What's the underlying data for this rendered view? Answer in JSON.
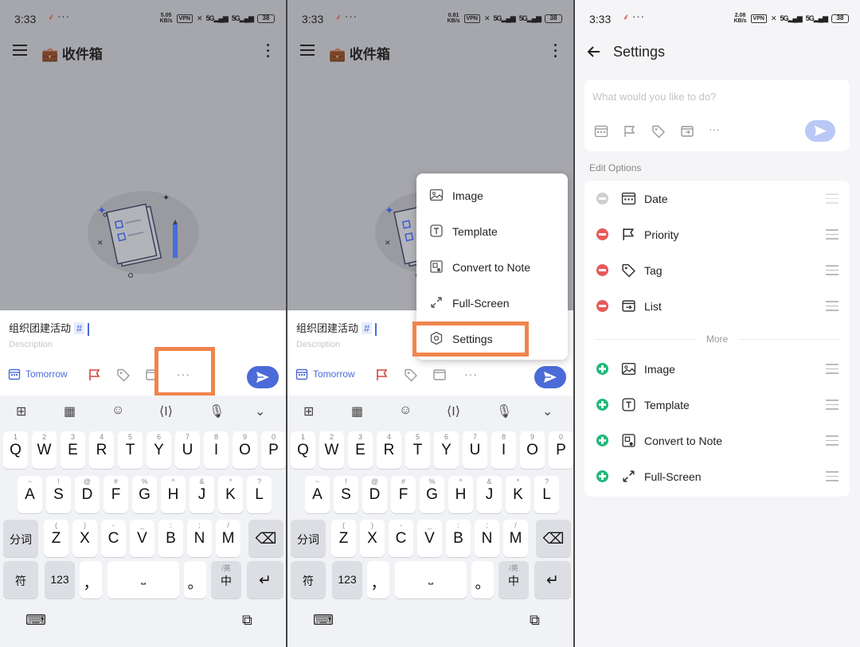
{
  "status_bar": {
    "time": "3:33",
    "dots": "···",
    "speeds": [
      "5.05",
      "0.81",
      "2.08"
    ],
    "speed_unit": "KB/s",
    "vpn": "VPN",
    "network": "5G",
    "battery": "38"
  },
  "app": {
    "title": "收件箱",
    "title_icon": "briefcase-icon"
  },
  "task_input": {
    "title_value": "组织团建活动",
    "tag_symbol": "#",
    "description_placeholder": "Description",
    "date_label": "Tomorrow",
    "more_label": "···"
  },
  "keyboard": {
    "row1": [
      {
        "main": "Q",
        "sub": "1"
      },
      {
        "main": "W",
        "sub": "2"
      },
      {
        "main": "E",
        "sub": "3"
      },
      {
        "main": "R",
        "sub": "4"
      },
      {
        "main": "T",
        "sub": "5"
      },
      {
        "main": "Y",
        "sub": "6"
      },
      {
        "main": "U",
        "sub": "7"
      },
      {
        "main": "I",
        "sub": "8"
      },
      {
        "main": "O",
        "sub": "9"
      },
      {
        "main": "P",
        "sub": "0"
      }
    ],
    "row2": [
      {
        "main": "A",
        "sub": "~"
      },
      {
        "main": "S",
        "sub": "!"
      },
      {
        "main": "D",
        "sub": "@"
      },
      {
        "main": "F",
        "sub": "#"
      },
      {
        "main": "G",
        "sub": "%"
      },
      {
        "main": "H",
        "sub": "^"
      },
      {
        "main": "J",
        "sub": "&"
      },
      {
        "main": "K",
        "sub": "*"
      },
      {
        "main": "L",
        "sub": "?"
      }
    ],
    "row3": [
      {
        "main": "Z",
        "sub": "("
      },
      {
        "main": "X",
        "sub": ")"
      },
      {
        "main": "C",
        "sub": "-"
      },
      {
        "main": "V",
        "sub": "_"
      },
      {
        "main": "B",
        "sub": ":"
      },
      {
        "main": "N",
        "sub": ";"
      },
      {
        "main": "M",
        "sub": "/"
      }
    ],
    "segment_key": "分词",
    "symbol_key": "符",
    "number_key": "123",
    "comma_key": "，",
    "period_key": "。",
    "lang_key": "中",
    "lang_sub": "/英"
  },
  "popup_menu": {
    "items": [
      {
        "label": "Image",
        "icon": "image-icon"
      },
      {
        "label": "Template",
        "icon": "template-icon"
      },
      {
        "label": "Convert to Note",
        "icon": "convert-note-icon"
      },
      {
        "label": "Full-Screen",
        "icon": "fullscreen-icon"
      },
      {
        "label": "Settings",
        "icon": "settings-hexagon-icon"
      }
    ]
  },
  "settings": {
    "title": "Settings",
    "quick_add_placeholder": "What would you like to do?",
    "section_label": "Edit Options",
    "more_label": "More",
    "enabled_options": [
      {
        "label": "Date",
        "icon": "calendar-icon",
        "state": "locked"
      },
      {
        "label": "Priority",
        "icon": "flag-icon",
        "state": "remove"
      },
      {
        "label": "Tag",
        "icon": "tag-icon",
        "state": "remove"
      },
      {
        "label": "List",
        "icon": "list-move-icon",
        "state": "remove"
      }
    ],
    "more_options": [
      {
        "label": "Image",
        "icon": "image-icon",
        "state": "add"
      },
      {
        "label": "Template",
        "icon": "template-icon",
        "state": "add"
      },
      {
        "label": "Convert to Note",
        "icon": "convert-note-icon",
        "state": "add"
      },
      {
        "label": "Full-Screen",
        "icon": "fullscreen-icon",
        "state": "add"
      }
    ]
  },
  "colors": {
    "accent": "#4a6bd8",
    "highlight": "#f0844c",
    "remove": "#e85a5a",
    "add": "#21b87a",
    "priority_flag": "#d8453f"
  }
}
